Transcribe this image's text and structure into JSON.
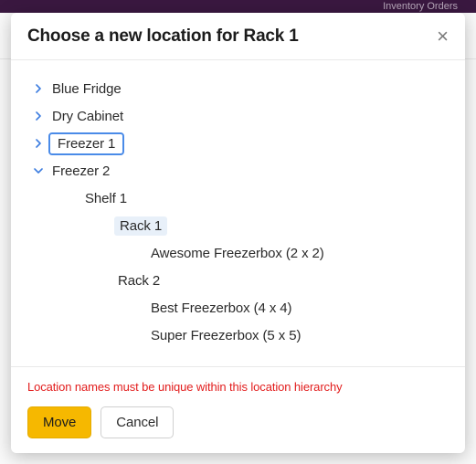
{
  "backdrop": {
    "nav_right": "Inventory   Orders"
  },
  "modal": {
    "title": "Choose a new location for Rack 1",
    "close_label": "×"
  },
  "tree": [
    {
      "label": "Blue Fridge",
      "depth": 0,
      "expanded": false,
      "selected": false,
      "highlighted": false,
      "has_children": true
    },
    {
      "label": "Dry Cabinet",
      "depth": 0,
      "expanded": false,
      "selected": false,
      "highlighted": false,
      "has_children": true
    },
    {
      "label": "Freezer 1",
      "depth": 0,
      "expanded": false,
      "selected": true,
      "highlighted": false,
      "has_children": true
    },
    {
      "label": "Freezer 2",
      "depth": 0,
      "expanded": true,
      "selected": false,
      "highlighted": false,
      "has_children": true
    },
    {
      "label": "Shelf 1",
      "depth": 1,
      "expanded": true,
      "selected": false,
      "highlighted": false,
      "has_children": true
    },
    {
      "label": "Rack 1",
      "depth": 2,
      "expanded": true,
      "selected": false,
      "highlighted": true,
      "has_children": true
    },
    {
      "label": "Awesome Freezerbox (2 x 2)",
      "depth": 3,
      "expanded": false,
      "selected": false,
      "highlighted": false,
      "has_children": false
    },
    {
      "label": "Rack 2",
      "depth": 2,
      "expanded": true,
      "selected": false,
      "highlighted": false,
      "has_children": true
    },
    {
      "label": "Best Freezerbox (4 x 4)",
      "depth": 3,
      "expanded": false,
      "selected": false,
      "highlighted": false,
      "has_children": false
    },
    {
      "label": "Super Freezerbox (5 x 5)",
      "depth": 3,
      "expanded": false,
      "selected": false,
      "highlighted": false,
      "has_children": false
    }
  ],
  "footer": {
    "error": "Location names must be unique within this location hierarchy",
    "move_label": "Move",
    "cancel_label": "Cancel"
  }
}
